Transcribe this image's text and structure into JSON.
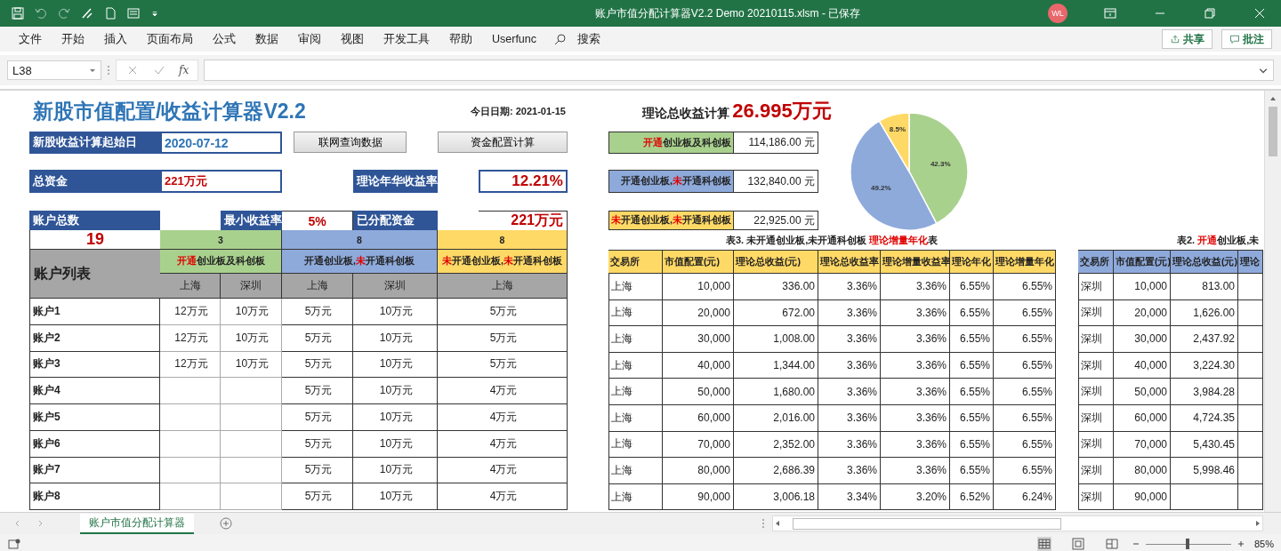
{
  "window": {
    "title": "账户市值分配计算器V2.2 Demo 20210115.xlsm  -  已保存",
    "user_initials": "WL"
  },
  "menu": [
    "文件",
    "开始",
    "插入",
    "页面布局",
    "公式",
    "数据",
    "审阅",
    "视图",
    "开发工具",
    "帮助",
    "Userfunc"
  ],
  "search": {
    "label": "搜索"
  },
  "share_button": "共享",
  "comments_button": "批注",
  "formula_bar": {
    "name_box": "L38",
    "function_label": "fx"
  },
  "sheet": {
    "title": "新股市值配置/收益计算器V2.2",
    "today": "今日日期: 2021-01-15",
    "start_date": {
      "label": "新股收益计算起始日",
      "value": "2020-07-12"
    },
    "buttons": [
      "联网查询数据",
      "资金配置计算"
    ],
    "total_funds": {
      "label": "总资金",
      "value": "221万元"
    },
    "annual_rate": {
      "label": "理论年华收益率",
      "value": "12.21%"
    },
    "account_count": {
      "label": "账户总数",
      "value": "19"
    },
    "min_rate": {
      "label": "最小收益率",
      "value": "5%"
    },
    "allocated": {
      "label": "已分配资金",
      "value": "221万元"
    },
    "groups": [
      {
        "count": "3",
        "color": "#a9d18e",
        "label": [
          {
            "text": "开通",
            "highlight": true
          },
          {
            "text": "创业板及科创板",
            "highlight": false
          }
        ]
      },
      {
        "count": "8",
        "color": "#8eaadb",
        "label": [
          {
            "text": "开通创业板,",
            "highlight": false
          },
          {
            "text": "未",
            "highlight": true
          },
          {
            "text": "开通科创板",
            "highlight": false
          }
        ]
      },
      {
        "count": "8",
        "color": "#ffd966",
        "label": [
          {
            "text": "未",
            "highlight": true
          },
          {
            "text": "开通创业板,",
            "highlight": false
          },
          {
            "text": "未",
            "highlight": true
          },
          {
            "text": "开通科创板",
            "highlight": false
          }
        ]
      }
    ],
    "account_list_label": "账户列表",
    "exchange_headers": [
      "上海",
      "深圳",
      "上海",
      "深圳",
      "上海"
    ],
    "accounts": [
      {
        "name": "账户1",
        "cells": {
          "g1_shanghai": "12万元",
          "g1_shenzhen": "10万元",
          "g2_shanghai": "5万元",
          "g2_shenzhen": "10万元",
          "g3_shanghai": "5万元"
        }
      },
      {
        "name": "账户2",
        "cells": {
          "g1_shanghai": "12万元",
          "g1_shenzhen": "10万元",
          "g2_shanghai": "5万元",
          "g2_shenzhen": "10万元",
          "g3_shanghai": "5万元"
        }
      },
      {
        "name": "账户3",
        "cells": {
          "g1_shanghai": "12万元",
          "g1_shenzhen": "10万元",
          "g2_shanghai": "5万元",
          "g2_shenzhen": "10万元",
          "g3_shanghai": "5万元"
        }
      },
      {
        "name": "账户4",
        "cells": {
          "g2_shanghai": "5万元",
          "g2_shenzhen": "10万元",
          "g3_shanghai": "4万元"
        }
      },
      {
        "name": "账户5",
        "cells": {
          "g2_shanghai": "5万元",
          "g2_shenzhen": "10万元",
          "g3_shanghai": "4万元"
        }
      },
      {
        "name": "账户6",
        "cells": {
          "g2_shanghai": "5万元",
          "g2_shenzhen": "10万元",
          "g3_shanghai": "4万元"
        }
      },
      {
        "name": "账户7",
        "cells": {
          "g2_shanghai": "5万元",
          "g2_shenzhen": "10万元",
          "g3_shanghai": "4万元"
        }
      },
      {
        "name": "账户8",
        "cells": {
          "g2_shanghai": "5万元",
          "g2_shenzhen": "10万元",
          "g3_shanghai": "4万元"
        }
      }
    ],
    "total_return": {
      "label": "理论总收益计算",
      "value": "26.995万元"
    },
    "group_returns": [
      {
        "color": "#a9d18e",
        "value": "114,186.00 元",
        "label": [
          {
            "text": "开通",
            "highlight": true
          },
          {
            "text": "创业板及科创板",
            "highlight": false
          }
        ]
      },
      {
        "color": "#8eaadb",
        "value": "132,840.00 元",
        "label": [
          {
            "text": "开通创业板,",
            "highlight": false
          },
          {
            "text": "未",
            "highlight": true
          },
          {
            "text": "开通科创板",
            "highlight": false
          }
        ]
      },
      {
        "color": "#ffd966",
        "value": "22,925.00 元",
        "label": [
          {
            "text": "未",
            "highlight": true
          },
          {
            "text": "开通创业板,",
            "highlight": false
          },
          {
            "text": "未",
            "highlight": true
          },
          {
            "text": "开通科创板",
            "highlight": false
          }
        ]
      }
    ],
    "chart_data": {
      "type": "pie",
      "values": [
        42.3,
        49.2,
        8.5
      ],
      "value_labels": [
        "42.3%",
        "49.2%",
        "8.5%"
      ]
    },
    "table3": {
      "caption": [
        {
          "text": "表3. 未开通创业板,未开通科创板  ",
          "highlight": false
        },
        {
          "text": "理论增量年化",
          "highlight": true
        },
        {
          "text": "表",
          "highlight": false
        }
      ],
      "columns": [
        "交易所",
        "市值配置(元)",
        "理论总收益(元)",
        "理论总收益率",
        "理论增量收益率",
        "理论年化",
        "理论增量年化"
      ],
      "rows": [
        [
          "上海",
          "10,000",
          "336.00",
          "3.36%",
          "3.36%",
          "6.55%",
          "6.55%"
        ],
        [
          "上海",
          "20,000",
          "672.00",
          "3.36%",
          "3.36%",
          "6.55%",
          "6.55%"
        ],
        [
          "上海",
          "30,000",
          "1,008.00",
          "3.36%",
          "3.36%",
          "6.55%",
          "6.55%"
        ],
        [
          "上海",
          "40,000",
          "1,344.00",
          "3.36%",
          "3.36%",
          "6.55%",
          "6.55%"
        ],
        [
          "上海",
          "50,000",
          "1,680.00",
          "3.36%",
          "3.36%",
          "6.55%",
          "6.55%"
        ],
        [
          "上海",
          "60,000",
          "2,016.00",
          "3.36%",
          "3.36%",
          "6.55%",
          "6.55%"
        ],
        [
          "上海",
          "70,000",
          "2,352.00",
          "3.36%",
          "3.36%",
          "6.55%",
          "6.55%"
        ],
        [
          "上海",
          "80,000",
          "2,686.39",
          "3.36%",
          "3.36%",
          "6.55%",
          "6.55%"
        ],
        [
          "上海",
          "90,000",
          "3,006.18",
          "3.34%",
          "3.20%",
          "6.52%",
          "6.24%"
        ]
      ]
    },
    "table2": {
      "caption": [
        {
          "text": "表2. ",
          "highlight": false
        },
        {
          "text": "开通",
          "highlight": true
        },
        {
          "text": "创业板,未",
          "highlight": false
        }
      ],
      "columns": [
        "交易所",
        "市值配置(元)",
        "理论总收益(元)",
        "理论"
      ],
      "rows": [
        [
          "深圳",
          "10,000",
          "813.00"
        ],
        [
          "深圳",
          "20,000",
          "1,626.00"
        ],
        [
          "深圳",
          "30,000",
          "2,437.92"
        ],
        [
          "深圳",
          "40,000",
          "3,224.30"
        ],
        [
          "深圳",
          "50,000",
          "3,984.28"
        ],
        [
          "深圳",
          "60,000",
          "4,724.35"
        ],
        [
          "深圳",
          "70,000",
          "5,430.45"
        ],
        [
          "深圳",
          "80,000",
          "5,998.46"
        ],
        [
          "深圳",
          "90,000"
        ]
      ]
    }
  },
  "sheet_tabs": [
    {
      "label": "账户市值分配计算器",
      "selected": true
    }
  ],
  "status_bar": {
    "zoom": "85%",
    "zoom_slider": {
      "level": 0.47
    }
  }
}
